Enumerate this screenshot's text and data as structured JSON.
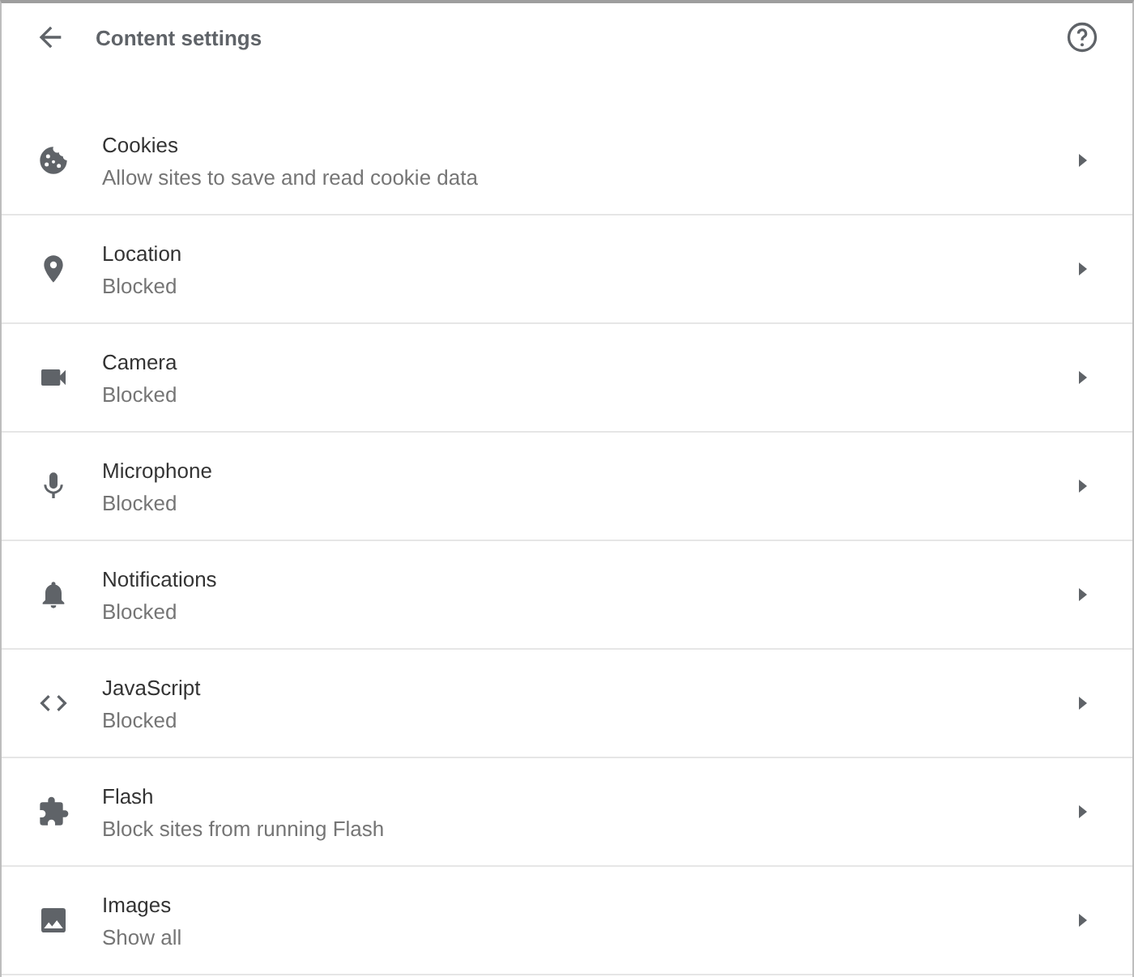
{
  "header": {
    "title": "Content settings"
  },
  "items": [
    {
      "kind": "cookies",
      "title": "Cookies",
      "subtitle": "Allow sites to save and read cookie data"
    },
    {
      "kind": "location",
      "title": "Location",
      "subtitle": "Blocked"
    },
    {
      "kind": "camera",
      "title": "Camera",
      "subtitle": "Blocked"
    },
    {
      "kind": "microphone",
      "title": "Microphone",
      "subtitle": "Blocked"
    },
    {
      "kind": "notifications",
      "title": "Notifications",
      "subtitle": "Blocked"
    },
    {
      "kind": "code",
      "title": "JavaScript",
      "subtitle": "Blocked"
    },
    {
      "kind": "plugin",
      "title": "Flash",
      "subtitle": "Block sites from running Flash"
    },
    {
      "kind": "images",
      "title": "Images",
      "subtitle": "Show all"
    }
  ]
}
